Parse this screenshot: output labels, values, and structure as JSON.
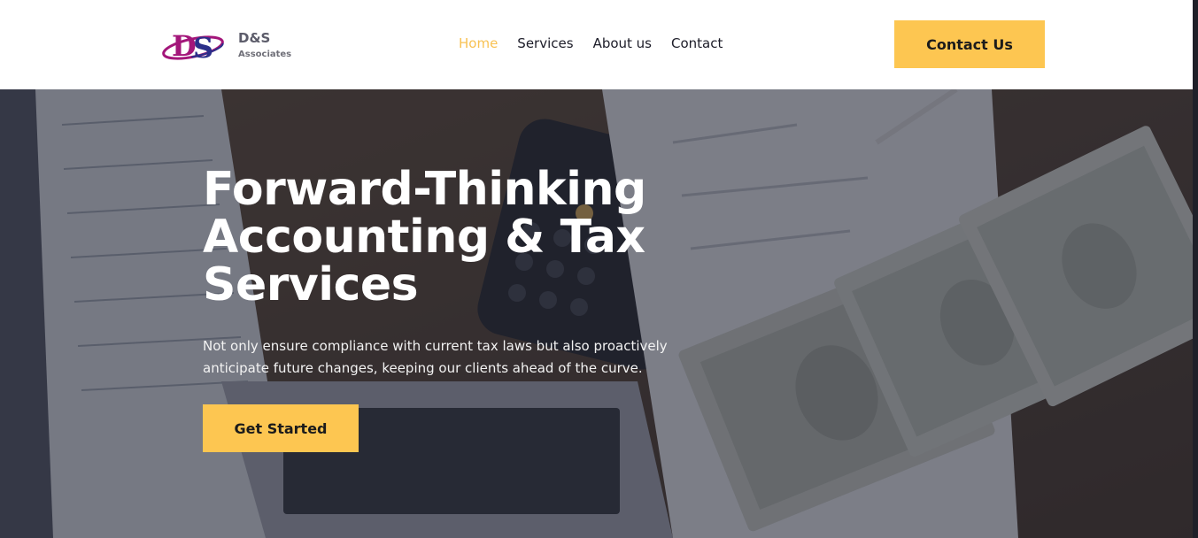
{
  "brand": {
    "name": "D&S",
    "tagline": "Associates",
    "mark_text": "DS",
    "colors": {
      "mark_primary": "#a3167a",
      "mark_secondary": "#2b2f8a"
    }
  },
  "nav": {
    "items": [
      {
        "label": "Home",
        "active": true
      },
      {
        "label": "Services",
        "active": false
      },
      {
        "label": "About us",
        "active": false
      },
      {
        "label": "Contact",
        "active": false
      }
    ],
    "active_color": "#f8c253"
  },
  "header": {
    "cta_label": "Contact Us"
  },
  "hero": {
    "title": "Forward-Thinking Accounting & Tax Services",
    "description": "Not only ensure compliance with current tax laws but also proactively anticipate future changes, keeping our clients ahead of the curve.",
    "button_label": "Get Started",
    "background": "laptop-calculator-cash-photo"
  },
  "colors": {
    "accent": "#fdc651",
    "overlay": "#24263a",
    "text_dark": "#1c1c28"
  }
}
